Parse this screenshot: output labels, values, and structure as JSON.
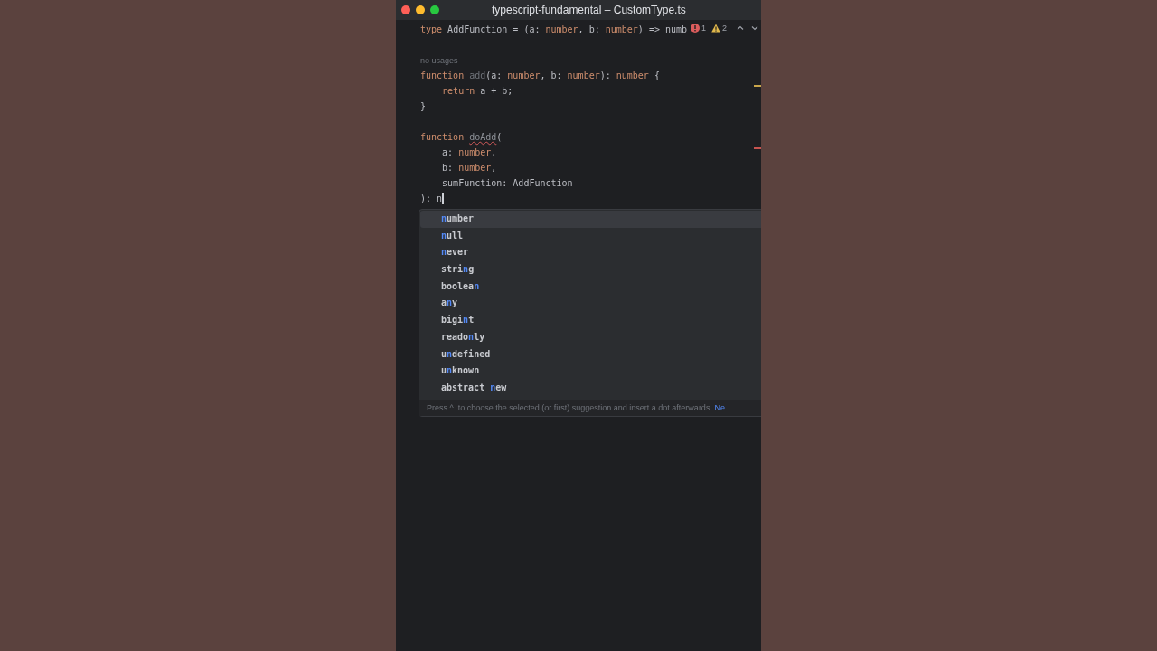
{
  "window": {
    "title": "typescript-fundamental – CustomType.ts"
  },
  "inspections": {
    "errors": "1",
    "warnings": "2"
  },
  "lines": [
    {
      "kind": "code",
      "tokens": [
        {
          "t": "type ",
          "kind": "kw"
        },
        {
          "t": "AddFunction = (a: ",
          "kind": "text"
        },
        {
          "t": "number",
          "kind": "kw"
        },
        {
          "t": ", b: ",
          "kind": "text"
        },
        {
          "t": "number",
          "kind": "kw"
        },
        {
          "t": ") => numb",
          "kind": "text"
        }
      ]
    },
    {
      "kind": "blank"
    },
    {
      "kind": "hint",
      "text": "no usages"
    },
    {
      "kind": "code",
      "tokens": [
        {
          "t": "function ",
          "kind": "kw"
        },
        {
          "t": "add",
          "kind": "unused"
        },
        {
          "t": "(a: ",
          "kind": "text"
        },
        {
          "t": "number",
          "kind": "kw"
        },
        {
          "t": ", b: ",
          "kind": "text"
        },
        {
          "t": "number",
          "kind": "kw"
        },
        {
          "t": "): ",
          "kind": "text"
        },
        {
          "t": "number",
          "kind": "kw"
        },
        {
          "t": " {",
          "kind": "text"
        }
      ]
    },
    {
      "kind": "code",
      "tokens": [
        {
          "t": "    return ",
          "kind": "kw"
        },
        {
          "t": "a + b;",
          "kind": "text"
        }
      ]
    },
    {
      "kind": "code",
      "tokens": [
        {
          "t": "}",
          "kind": "text"
        }
      ]
    },
    {
      "kind": "blank"
    },
    {
      "kind": "code",
      "tokens": [
        {
          "t": "function ",
          "kind": "kw"
        },
        {
          "t": "doAdd",
          "kind": "error"
        },
        {
          "t": "(",
          "kind": "text"
        }
      ]
    },
    {
      "kind": "code",
      "tokens": [
        {
          "t": "    a: ",
          "kind": "text"
        },
        {
          "t": "number",
          "kind": "kw"
        },
        {
          "t": ",",
          "kind": "text"
        }
      ]
    },
    {
      "kind": "code",
      "tokens": [
        {
          "t": "    b: ",
          "kind": "text"
        },
        {
          "t": "number",
          "kind": "kw"
        },
        {
          "t": ",",
          "kind": "text"
        }
      ]
    },
    {
      "kind": "code",
      "tokens": [
        {
          "t": "    sumFunction: AddFunction",
          "kind": "text"
        }
      ]
    },
    {
      "kind": "code",
      "caret": true,
      "tokens": [
        {
          "t": "): n",
          "kind": "text"
        }
      ]
    }
  ],
  "completion": {
    "items": [
      {
        "match": "n",
        "post": "umber",
        "selected": true
      },
      {
        "match": "n",
        "post": "ull",
        "selected": false
      },
      {
        "match": "n",
        "post": "ever",
        "selected": false
      },
      {
        "pre": "stri",
        "match": "n",
        "post": "g",
        "selected": false
      },
      {
        "pre": "boolea",
        "match": "n",
        "selected": false
      },
      {
        "pre": "a",
        "match": "n",
        "post": "y",
        "selected": false
      },
      {
        "pre": "bigi",
        "match": "n",
        "post": "t",
        "selected": false
      },
      {
        "pre": "reado",
        "match": "n",
        "post": "ly",
        "selected": false
      },
      {
        "pre": "u",
        "match": "n",
        "post": "defined",
        "selected": false
      },
      {
        "pre": "u",
        "match": "n",
        "post": "known",
        "selected": false
      },
      {
        "pre": "abstract ",
        "match": "n",
        "post": "ew",
        "selected": false
      }
    ],
    "footer": "Press ^. to choose the selected (or first) suggestion and insert a dot afterwards",
    "footer_link": "Ne"
  }
}
